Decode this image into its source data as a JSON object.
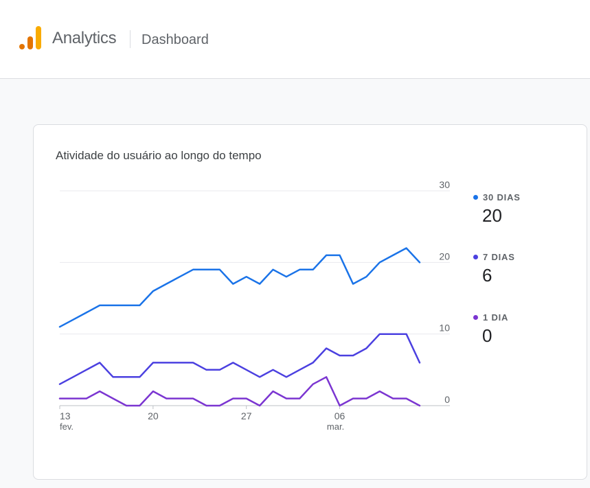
{
  "header": {
    "app_title": "Analytics",
    "page_name": "Dashboard",
    "logo_colors": [
      "#e37400",
      "#f9ab00"
    ]
  },
  "card": {
    "title": "Atividade do usuário ao longo do tempo"
  },
  "legend": [
    {
      "label": "30 DIAS",
      "value": "20",
      "color": "#1a73e8"
    },
    {
      "label": "7 DIAS",
      "value": "6",
      "color": "#4b40e0"
    },
    {
      "label": "1 DIA",
      "value": "0",
      "color": "#7b35d1"
    }
  ],
  "chart_data": {
    "type": "line",
    "x": [
      "13 fev.",
      "14",
      "15",
      "16",
      "17",
      "18",
      "19",
      "20",
      "21",
      "22",
      "23",
      "24",
      "25",
      "26",
      "27",
      "28",
      "01 mar.",
      "02",
      "03",
      "04",
      "05",
      "06",
      "07",
      "08",
      "09",
      "10",
      "11",
      "12"
    ],
    "x_tick_labels": [
      {
        "index": 0,
        "day": "13",
        "month": "fev."
      },
      {
        "index": 7,
        "day": "20",
        "month": ""
      },
      {
        "index": 14,
        "day": "27",
        "month": ""
      },
      {
        "index": 21,
        "day": "06",
        "month": "mar."
      }
    ],
    "ylim": [
      0,
      30
    ],
    "y_ticks": [
      0,
      10,
      20,
      30
    ],
    "y_axis_position": "right",
    "grid": true,
    "series": [
      {
        "name": "30 DIAS",
        "color": "#1a73e8",
        "values": [
          11,
          12,
          13,
          14,
          14,
          14,
          14,
          16,
          17,
          18,
          19,
          19,
          19,
          17,
          18,
          17,
          19,
          18,
          19,
          19,
          21,
          21,
          17,
          18,
          20,
          21,
          22,
          20
        ]
      },
      {
        "name": "7 DIAS",
        "color": "#4b40e0",
        "values": [
          3,
          4,
          5,
          6,
          4,
          4,
          4,
          6,
          6,
          6,
          6,
          5,
          5,
          6,
          5,
          4,
          5,
          4,
          5,
          6,
          8,
          7,
          7,
          8,
          10,
          10,
          10,
          6
        ]
      },
      {
        "name": "1 DIA",
        "color": "#7b35d1",
        "values": [
          1,
          1,
          1,
          2,
          1,
          0,
          0,
          2,
          1,
          1,
          1,
          0,
          0,
          1,
          1,
          0,
          2,
          1,
          1,
          3,
          4,
          0,
          1,
          1,
          2,
          1,
          1,
          0
        ]
      }
    ]
  }
}
